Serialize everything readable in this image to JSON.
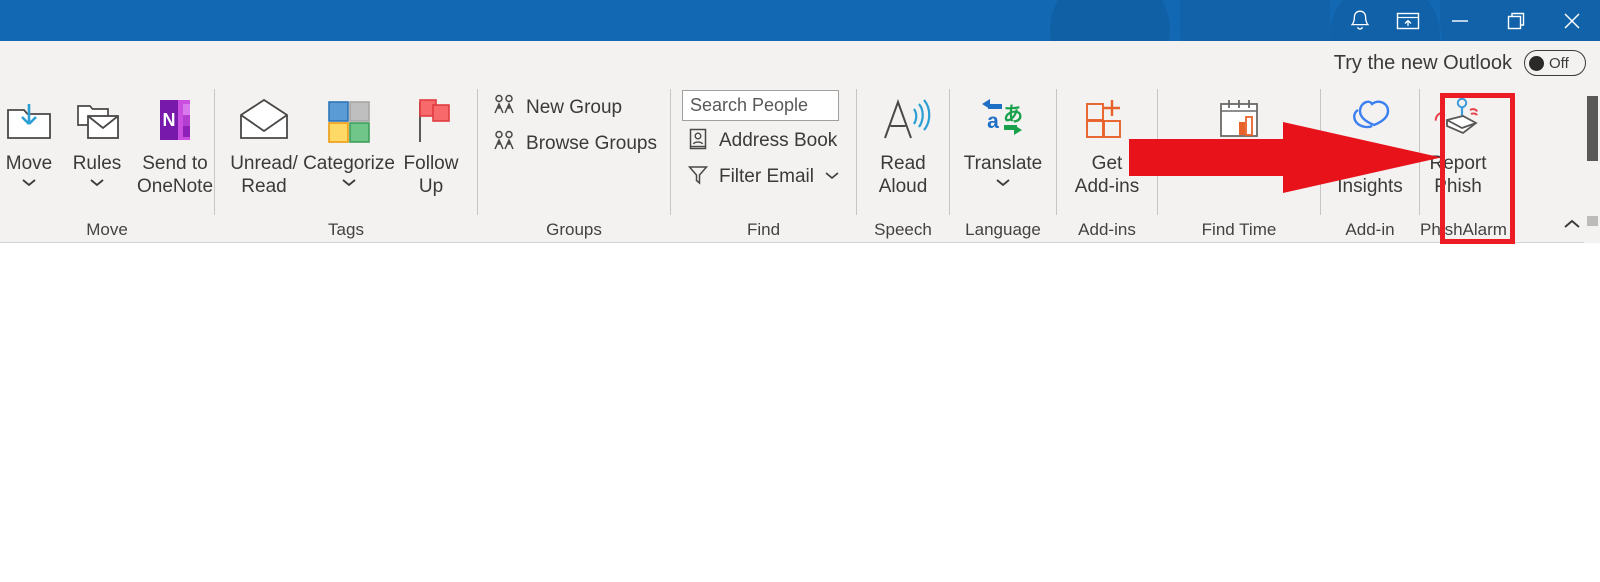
{
  "titlebar": {
    "buttons": [
      {
        "name": "notifications-bell-icon",
        "label": "Notifications"
      },
      {
        "name": "restore-pane-icon",
        "label": "Restore Down Pane"
      },
      {
        "name": "minimize-icon",
        "label": "Minimize"
      },
      {
        "name": "maximize-restore-icon",
        "label": "Restore"
      },
      {
        "name": "close-icon",
        "label": "Close"
      }
    ],
    "color": "#1268b3"
  },
  "ribbon": {
    "try_new_outlook": {
      "label": "Try the new Outlook",
      "toggle_state": "Off"
    },
    "collapse_label": "^",
    "groups": [
      {
        "name": "Move",
        "items": [
          {
            "label": "Move",
            "icon": "move-to-folder-icon",
            "has_dropdown": true
          },
          {
            "label": "Rules",
            "icon": "rules-icon",
            "has_dropdown": true
          },
          {
            "label": "Send to\nOneNote",
            "icon": "onenote-icon",
            "has_dropdown": false
          }
        ]
      },
      {
        "name": "Tags",
        "items": [
          {
            "label": "Unread/\nRead",
            "icon": "unread-read-envelope-icon",
            "has_dropdown": false
          },
          {
            "label": "Categorize",
            "icon": "categorize-icon",
            "has_dropdown": true
          },
          {
            "label": "Follow\nUp",
            "icon": "follow-up-flag-icon",
            "has_dropdown": true
          }
        ]
      },
      {
        "name": "Groups",
        "items": [
          {
            "label": "New Group",
            "icon": "new-group-icon"
          },
          {
            "label": "Browse Groups",
            "icon": "browse-groups-icon"
          }
        ]
      },
      {
        "name": "Find",
        "search_placeholder": "Search People",
        "items": [
          {
            "label": "Address Book",
            "icon": "address-book-icon"
          },
          {
            "label": "Filter Email",
            "icon": "filter-icon",
            "has_dropdown": true
          }
        ]
      },
      {
        "name": "Speech",
        "items": [
          {
            "label": "Read\nAloud",
            "icon": "read-aloud-icon",
            "has_dropdown": false
          }
        ]
      },
      {
        "name": "Language",
        "items": [
          {
            "label": "Translate",
            "icon": "translate-icon",
            "has_dropdown": true
          }
        ]
      },
      {
        "name": "Add-ins",
        "items": [
          {
            "label": "Get\nAdd-ins",
            "icon": "get-add-ins-icon",
            "has_dropdown": false
          }
        ]
      },
      {
        "name": "Find Time",
        "items": [
          {
            "label": "Scheduling Poll",
            "icon": "scheduling-poll-calendar-icon",
            "has_dropdown": false
          }
        ]
      },
      {
        "name": "Add-in",
        "items": [
          {
            "label": "Viva\nInsights",
            "icon": "viva-insights-icon",
            "has_dropdown": false
          }
        ]
      },
      {
        "name": "PhishAlarm",
        "highlighted": true,
        "items": [
          {
            "label": "Report\nPhish",
            "icon": "report-phish-icon",
            "has_dropdown": false
          }
        ]
      }
    ]
  },
  "annotation": {
    "arrow_color": "#e8121b",
    "highlight_box_color": "#ed1c24",
    "points_to": "Report Phish"
  }
}
